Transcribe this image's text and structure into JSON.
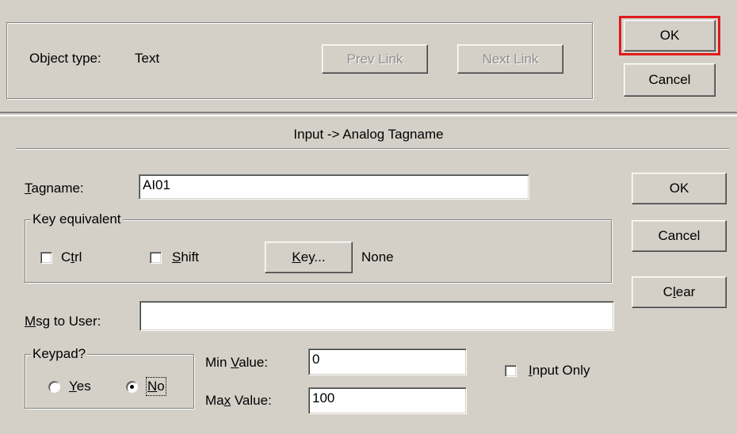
{
  "top": {
    "object_type_label": "Object type:",
    "object_type_value": "Text",
    "prev_link_label": "Prev Link",
    "next_link_label": "Next Link",
    "ok_label": "OK",
    "cancel_label": "Cancel"
  },
  "section_title": "Input -> Analog Tagname",
  "tagname": {
    "label": "Tagname:",
    "value": "AI01"
  },
  "key_equivalent": {
    "legend": "Key equivalent",
    "ctrl_label": "Ctrl",
    "ctrl_checked": false,
    "shift_label": "Shift",
    "shift_checked": false,
    "key_button_label": "Key...",
    "key_value": "None"
  },
  "msg_to_user": {
    "label": "Msg to User:",
    "value": ""
  },
  "keypad": {
    "legend": "Keypad?",
    "yes_label": "Yes",
    "no_label": "No",
    "selected": "No"
  },
  "min_value": {
    "label": "Min Value:",
    "value": "0"
  },
  "max_value": {
    "label": "Max Value:",
    "value": "100"
  },
  "input_only": {
    "label": "Input Only",
    "checked": false
  },
  "side_buttons": {
    "ok_label": "OK",
    "cancel_label": "Cancel",
    "clear_label": "Clear"
  },
  "colors": {
    "dialog_bg": "#d4d0c8",
    "highlight_border": "#e01b1b"
  }
}
